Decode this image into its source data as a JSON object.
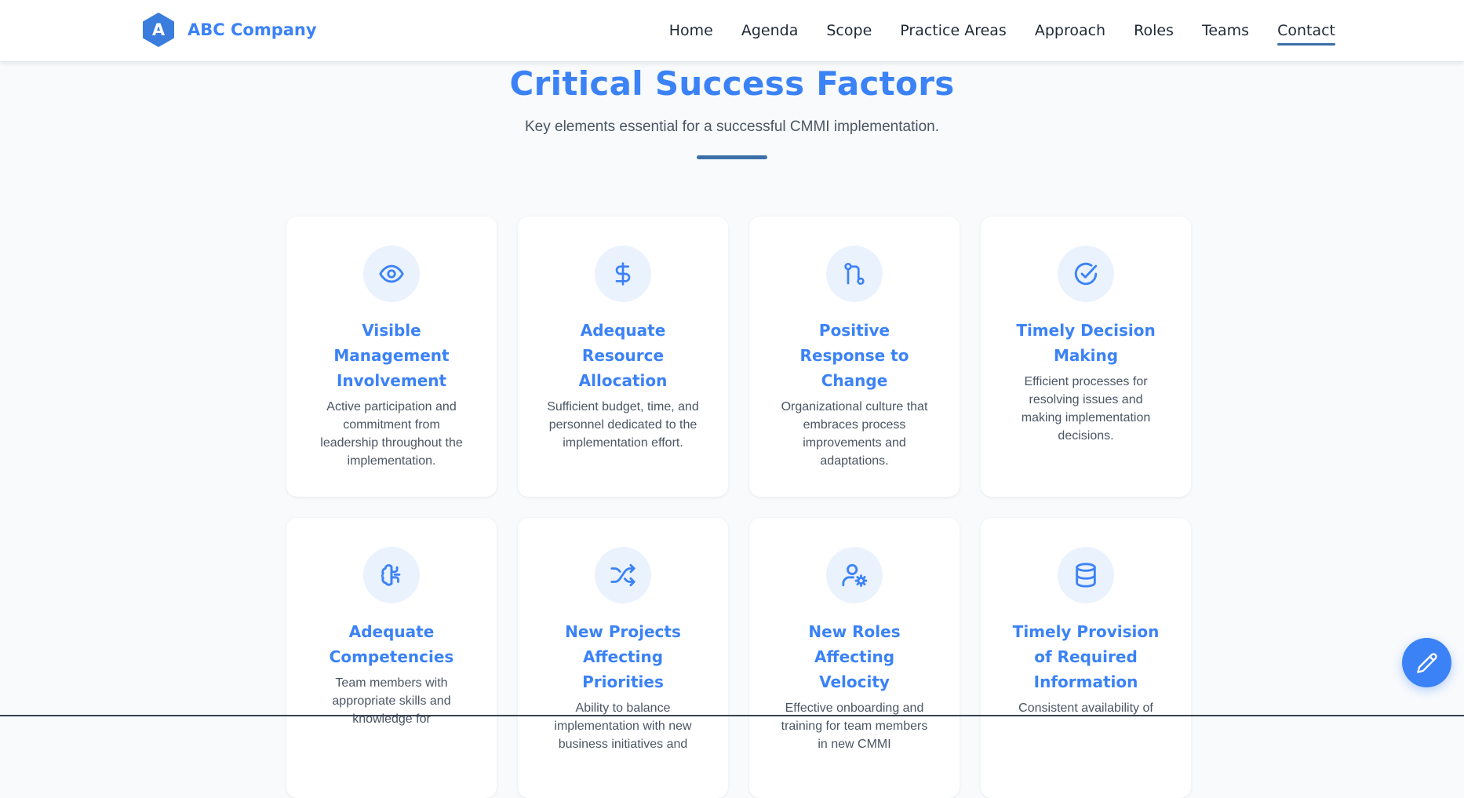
{
  "brand": {
    "logo_letter": "A",
    "name": "ABC Company"
  },
  "nav": {
    "items": [
      {
        "label": "Home"
      },
      {
        "label": "Agenda"
      },
      {
        "label": "Scope"
      },
      {
        "label": "Practice Areas"
      },
      {
        "label": "Approach"
      },
      {
        "label": "Roles"
      },
      {
        "label": "Teams"
      },
      {
        "label": "Contact",
        "active": true
      }
    ]
  },
  "section": {
    "title": "Critical Success Factors",
    "subtitle": "Key elements essential for a successful CMMI implementation."
  },
  "cards": [
    {
      "icon": "eye-icon",
      "title": "Visible Management Involvement",
      "text": "Active participation and commitment from leadership throughout the implementation."
    },
    {
      "icon": "dollar-icon",
      "title": "Adequate Resource Allocation",
      "text": "Sufficient budget, time, and personnel dedicated to the implementation effort."
    },
    {
      "icon": "git-compare-icon",
      "title": "Positive Response to Change",
      "text": "Organizational culture that embraces process improvements and adaptations."
    },
    {
      "icon": "check-circle-icon",
      "title": "Timely Decision Making",
      "text": "Efficient processes for resolving issues and making implementation decisions."
    },
    {
      "icon": "brain-icon",
      "title": "Adequate Competencies",
      "text": "Team members with appropriate skills and knowledge for"
    },
    {
      "icon": "shuffle-icon",
      "title": "New Projects Affecting Priorities",
      "text": "Ability to balance implementation with new business initiatives and"
    },
    {
      "icon": "user-gear-icon",
      "title": "New Roles Affecting Velocity",
      "text": "Effective onboarding and training for team members in new CMMI"
    },
    {
      "icon": "database-icon",
      "title": "Timely Provision of Required Information",
      "text": "Consistent availability of"
    }
  ],
  "colors": {
    "accent": "#3b82f6",
    "divider": "#3b6fa8",
    "icon_bg": "#eaf2fe",
    "page_bg": "#f8fafc"
  },
  "fab": {
    "icon": "pencil-icon"
  }
}
